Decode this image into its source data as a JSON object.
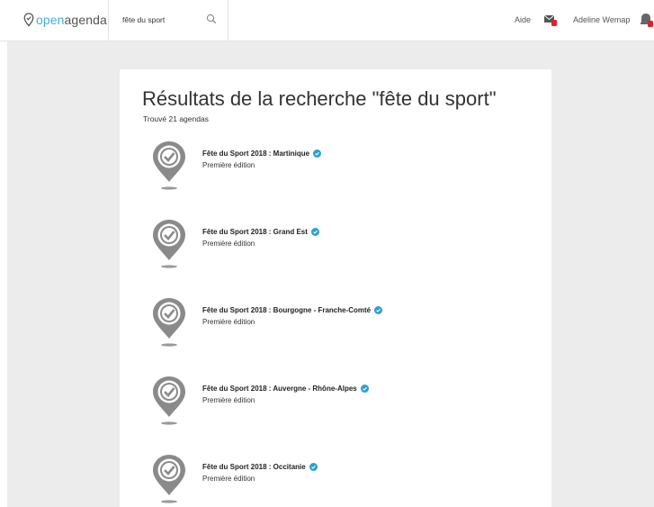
{
  "header": {
    "logo_open": "open",
    "logo_agenda": "agenda",
    "search_value": "fête du sport",
    "help_label": "Aide",
    "user_name": "Adeline Wemap"
  },
  "main": {
    "title": "Résultats de la recherche \"fête du sport\"",
    "count": "Trouvé 21 agendas",
    "results": [
      {
        "name": "Fête du Sport 2018 : Martinique",
        "subtitle": "Première édition"
      },
      {
        "name": "Fête du Sport 2018 : Grand Est",
        "subtitle": "Première édition"
      },
      {
        "name": "Fête du Sport 2018 : Bourgogne - Franche-Comté",
        "subtitle": "Première édition"
      },
      {
        "name": "Fête du Sport 2018 : Auvergne - Rhône-Alpes",
        "subtitle": "Première édition"
      },
      {
        "name": "Fête du Sport 2018 : Occitanie",
        "subtitle": "Première édition"
      }
    ]
  },
  "colors": {
    "brand": "#41acdd",
    "verified": "#2e9fd6",
    "pin_gray": "#8a8a8a",
    "background": "#ececec",
    "notification": "#d9232f"
  },
  "icons": {
    "logo": "location-pin-icon",
    "search": "magnifier-icon",
    "messages": "mail-icon",
    "notifications": "bell-icon",
    "result": "agenda-pin-check-icon",
    "verified": "verified-check-icon"
  }
}
